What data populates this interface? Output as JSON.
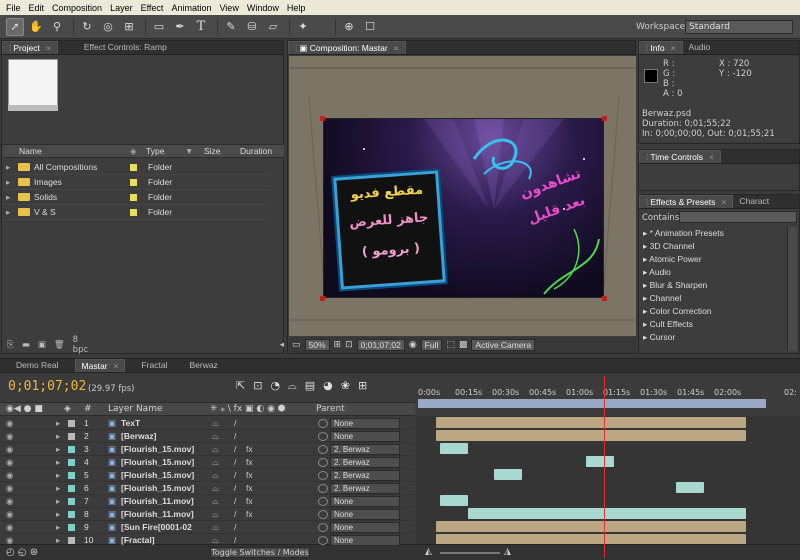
{
  "menu": [
    "File",
    "Edit",
    "Composition",
    "Layer",
    "Effect",
    "Animation",
    "View",
    "Window",
    "Help"
  ],
  "workspace": {
    "label": "Workspace:",
    "value": "Standard"
  },
  "project": {
    "tabs": [
      "Project",
      "Effect Controls: Ramp"
    ],
    "columns": [
      "Name",
      "Type",
      "Size",
      "Duration"
    ],
    "items": [
      {
        "name": "All Compositions",
        "type": "Folder"
      },
      {
        "name": "Images",
        "type": "Folder"
      },
      {
        "name": "Solids",
        "type": "Folder"
      },
      {
        "name": "V & S",
        "type": "Folder"
      }
    ],
    "bpc": "8 bpc"
  },
  "composition": {
    "tab": "Composition: Mastar",
    "zoom": "50%",
    "timecode": "0;01;07;02",
    "resolution": "Full",
    "camera": "Active Camera",
    "art_text": {
      "box_line1": "مقطع فديو",
      "box_line2": "جاهز للعرض",
      "box_line3": "( برومو )",
      "side_line1": "تشاهدون",
      "side_line2": "بعد قليل"
    },
    "accent": "#3aa0d8"
  },
  "info": {
    "tabs": [
      "Info",
      "Audio"
    ],
    "r": "R :",
    "g": "G :",
    "b": "B :",
    "a": "A : 0",
    "x": "X : 720",
    "y": "Y : -120",
    "file": "Berwaz.psd",
    "duration": "Duration: 0;01;55;22",
    "inout": "In: 0;00;00;00, Out: 0;01;55;21"
  },
  "time_controls": {
    "tab": "Time Controls"
  },
  "effects": {
    "tabs": [
      "Effects & Presets",
      "Charact"
    ],
    "contains_label": "Contains:",
    "items": [
      "* Animation Presets",
      "3D Channel",
      "Atomic Power",
      "Audio",
      "Blur & Sharpen",
      "Channel",
      "Color Correction",
      "Cult Effects",
      "Cursor"
    ]
  },
  "timeline": {
    "tabs": [
      "Demo Real",
      "Mastar",
      "Fractal",
      "Berwaz"
    ],
    "timecode": "0;01;07;02",
    "fps": "(29.97 fps)",
    "headers": {
      "num": "#",
      "name": "Layer Name",
      "parent": "Parent"
    },
    "ruler": [
      "0:00s",
      "00:15s",
      "00:30s",
      "00:45s",
      "01:00s",
      "01:15s",
      "01:30s",
      "01:45s",
      "02:00s"
    ],
    "ruler_end": "02:",
    "layers": [
      {
        "num": "1",
        "name": "TexT",
        "color": "#b9b9b9",
        "parent": "None",
        "fx": false
      },
      {
        "num": "2",
        "name": "[Berwaz]",
        "color": "#b9b9b9",
        "parent": "None",
        "fx": false
      },
      {
        "num": "3",
        "name": "[Flourish_15.mov]",
        "color": "#7fd0c8",
        "parent": "2. Berwaz",
        "fx": true
      },
      {
        "num": "4",
        "name": "[Flourish_15.mov]",
        "color": "#7fd0c8",
        "parent": "2. Berwaz",
        "fx": true
      },
      {
        "num": "5",
        "name": "[Flourish_15.mov]",
        "color": "#7fd0c8",
        "parent": "2. Berwaz",
        "fx": true
      },
      {
        "num": "6",
        "name": "[Flourish_15.mov]",
        "color": "#7fd0c8",
        "parent": "2. Berwaz",
        "fx": true
      },
      {
        "num": "7",
        "name": "[Flourish_11.mov]",
        "color": "#7fd0c8",
        "parent": "None",
        "fx": true
      },
      {
        "num": "8",
        "name": "[Flourish_11.mov]",
        "color": "#7fd0c8",
        "parent": "None",
        "fx": true
      },
      {
        "num": "9",
        "name": "[Sun Fire[0001-02",
        "color": "#7fd0c8",
        "parent": "None",
        "fx": false
      },
      {
        "num": "10",
        "name": "[Fractal]",
        "color": "#b9b9b9",
        "parent": "None",
        "fx": false
      }
    ],
    "toggle_label": "Toggle Switches / Modes"
  }
}
